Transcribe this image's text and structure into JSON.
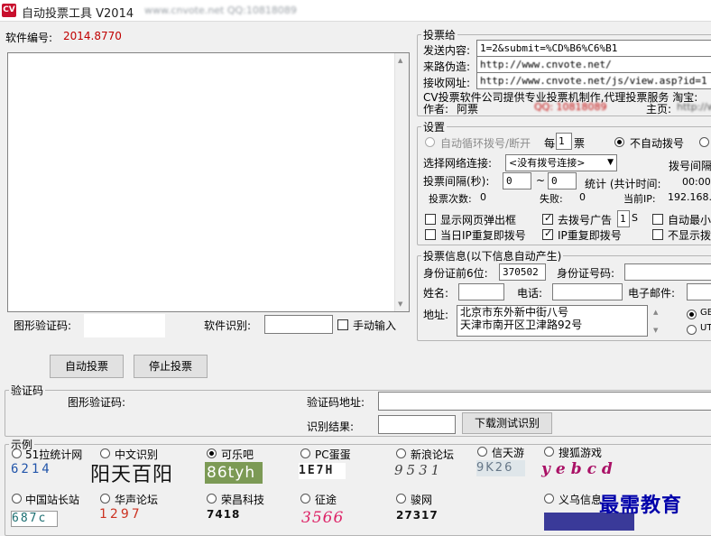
{
  "title": "自动投票工具 V2014",
  "title_blur": "www.cnvote.net  QQ:10818089",
  "software_id_label": "软件编号:",
  "software_id_value": "2014.8770",
  "left": {
    "captcha_img_label": "图形验证码:",
    "soft_recog_label": "软件识别:",
    "manual_input_label": "手动输入",
    "auto_vote": "自动投票",
    "stop_vote": "停止投票"
  },
  "vote": {
    "legend": "投票给",
    "send_label": "发送内容:",
    "send_value": "1=2&submit=%CD%B6%C6%B1",
    "referer_label": "来路伪造:",
    "referer_value": "http://www.cnvote.net/",
    "recv_label": "接收网址:",
    "recv_value": "http://www.cnvote.net/js/view.asp?id=1",
    "company_line": "CV投票软件公司提供专业投票机制作,代理投票服务  淘宝:",
    "author_label": "作者:",
    "author_value": "阿票",
    "author_qq": "QQ: 10818089",
    "home_label": "主页:",
    "home_value": "http://www."
  },
  "settings": {
    "legend": "设置",
    "auto_dial": "自动循环拨号/断开",
    "per_label": "每",
    "per_value": "1",
    "ticket": "票",
    "no_auto_dial": "不自动拨号",
    "net_label": "选择网络连接:",
    "net_value": "<没有拨号连接>",
    "dial_interval": "拨号间隔",
    "vote_interval": "投票间隔(秒):",
    "interval_from": "0",
    "tilde": "~",
    "interval_to": "0",
    "stats_label": "统计 (共计时间:",
    "stats_time": "00:00",
    "count_label": "投票次数:",
    "count_value": "0",
    "fail_label": "失败:",
    "fail_value": "0",
    "ip_label": "当前IP:",
    "ip_value": "192.168.",
    "show_popup": "显示网页弹出框",
    "remove_ad": "去拨号广告",
    "ad_value": "1",
    "ad_unit": "S",
    "auto_min": "自动最小",
    "ip_redial_today": "当日IP重复即拨号",
    "ip_redial": "IP重复即拨号",
    "no_show": "不显示拨"
  },
  "info": {
    "legend": "投票信息(以下信息自动产生)",
    "id6_label": "身份证前6位:",
    "id6_value": "370502",
    "id_label": "身份证号码:",
    "name_label": "姓名:",
    "phone_label": "电话:",
    "email_label": "电子邮件:",
    "addr_label": "地址:",
    "addr_line1": "北京市东外新中街八号",
    "addr_line2": "天津市南开区卫津路92号",
    "enc1": "GB",
    "enc2": "UT"
  },
  "captcha": {
    "legend": "验证码",
    "img_label": "图形验证码:",
    "url_label": "验证码地址:",
    "result_label": "识别结果:",
    "download_btn": "下载测试识别"
  },
  "examples": {
    "legend": "示例",
    "items": [
      {
        "name": "51拉统计网",
        "code": "6214",
        "color": "#2255aa",
        "checked": false
      },
      {
        "name": "中文识别",
        "code": "阳天百阳",
        "color": "#111111",
        "checked": false
      },
      {
        "name": "可乐吧",
        "code": "86tyh",
        "color": "#ffffff",
        "checked": true
      },
      {
        "name": "PC蛋蛋",
        "code": "1E7H",
        "color": "#222222",
        "checked": false
      },
      {
        "name": "新浪论坛",
        "code": "9531",
        "color": "#444444",
        "checked": false
      },
      {
        "name": "信天游",
        "code": "9K26",
        "color": "#667788",
        "checked": false
      },
      {
        "name": "搜狐游戏",
        "code": "yebcd",
        "color": "#aa1166",
        "checked": false
      },
      {
        "name": "中国站长站",
        "code": "687c",
        "color": "#1a6d70",
        "checked": false
      },
      {
        "name": "华声论坛",
        "code": "1297",
        "color": "#cc3322",
        "checked": false
      },
      {
        "name": "荣昌科技",
        "code": "7418",
        "color": "#111111",
        "checked": false
      },
      {
        "name": "征途",
        "code": "3566",
        "color": "#dd2266",
        "checked": false
      },
      {
        "name": "骏网",
        "code": "27317",
        "color": "#111111",
        "checked": false
      },
      {
        "name": "义乌信息",
        "code": "",
        "color": "#111111",
        "checked": false
      }
    ]
  },
  "watermark": "最需教育",
  "colors": {
    "accent_red": "#c00000",
    "selection_blue": "#0000aa"
  }
}
